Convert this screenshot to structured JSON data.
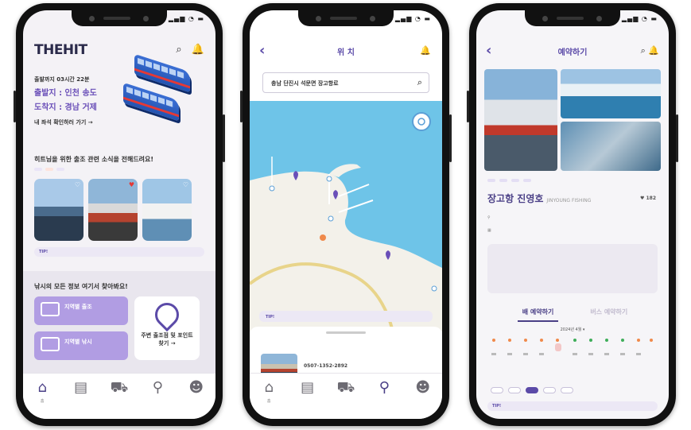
{
  "phone1": {
    "logo": "THEHIT",
    "bus": {
      "notice_line": "",
      "countdown": "출발까지 03시간 22분",
      "departure": "출발지 : 인천 송도",
      "arrival": "도착지 : 경남 거제",
      "check_seat": "내 좌석 확인하러 가기 →"
    },
    "news_title": "히트님을 위한 출조 관련 소식을 전해드려요!",
    "chips": [
      "",
      "",
      ""
    ],
    "more": "",
    "cards": [
      {
        "caption": ""
      },
      {
        "caption": ""
      },
      {
        "caption": ""
      }
    ],
    "tip_label": "TIP!",
    "tip_text": "",
    "info_title": "낚시의 모든 정보 여기서 찾아봐요!",
    "btn_region_bus": "지역별 출조",
    "btn_region_bus_sub": "",
    "btn_region_boat": "지역별 낚시",
    "btn_region_boat_sub": "",
    "btn_nearby": "주변 출조점 및 포인트 찾기 →",
    "tabs": [
      {
        "icon": "home-icon",
        "label": "홈"
      },
      {
        "icon": "chat-icon",
        "label": ""
      },
      {
        "icon": "cart-icon",
        "label": ""
      },
      {
        "icon": "pin-icon",
        "label": ""
      },
      {
        "icon": "person-icon",
        "label": ""
      }
    ]
  },
  "phone2": {
    "title": "위 치",
    "search_value": "충남 단진시 석문면 장고항로",
    "map_labels": [],
    "tip_label": "TIP!",
    "tip_text": "",
    "result_header": "",
    "result_addr": "",
    "result_phone": "0507-1352-2892",
    "tabs": [
      {
        "icon": "home-icon",
        "label": "홈"
      },
      {
        "icon": "chat-icon",
        "label": ""
      },
      {
        "icon": "cart-icon",
        "label": ""
      },
      {
        "icon": "pin-icon",
        "label": ""
      },
      {
        "icon": "person-icon",
        "label": ""
      }
    ]
  },
  "phone3": {
    "title": "예약하기",
    "tags": [
      "",
      "",
      "",
      ""
    ],
    "ship_name": "장고항 진영호",
    "ship_name_en": "JINYOUNG FISHING",
    "likes": "182",
    "address": "",
    "hours": "",
    "description": "",
    "tab_boat": "배 예약하기",
    "tab_bus": "버스 예약하기",
    "month": "2024년 4월",
    "times": [
      "",
      "",
      "",
      "",
      ""
    ],
    "tip_label": "TIP!",
    "tip_text": "",
    "tabs": [
      {
        "icon": "home-icon",
        "label": "홈"
      },
      {
        "icon": "chat-icon",
        "label": ""
      },
      {
        "icon": "cart-icon",
        "label": ""
      },
      {
        "icon": "pin-icon",
        "label": ""
      },
      {
        "icon": "person-icon",
        "label": ""
      }
    ]
  },
  "colors": {
    "brand_purple": "#5b4aa8",
    "light_purple": "#b19de3",
    "sea_blue": "#6ec4e8",
    "land": "#f3f1ea"
  }
}
